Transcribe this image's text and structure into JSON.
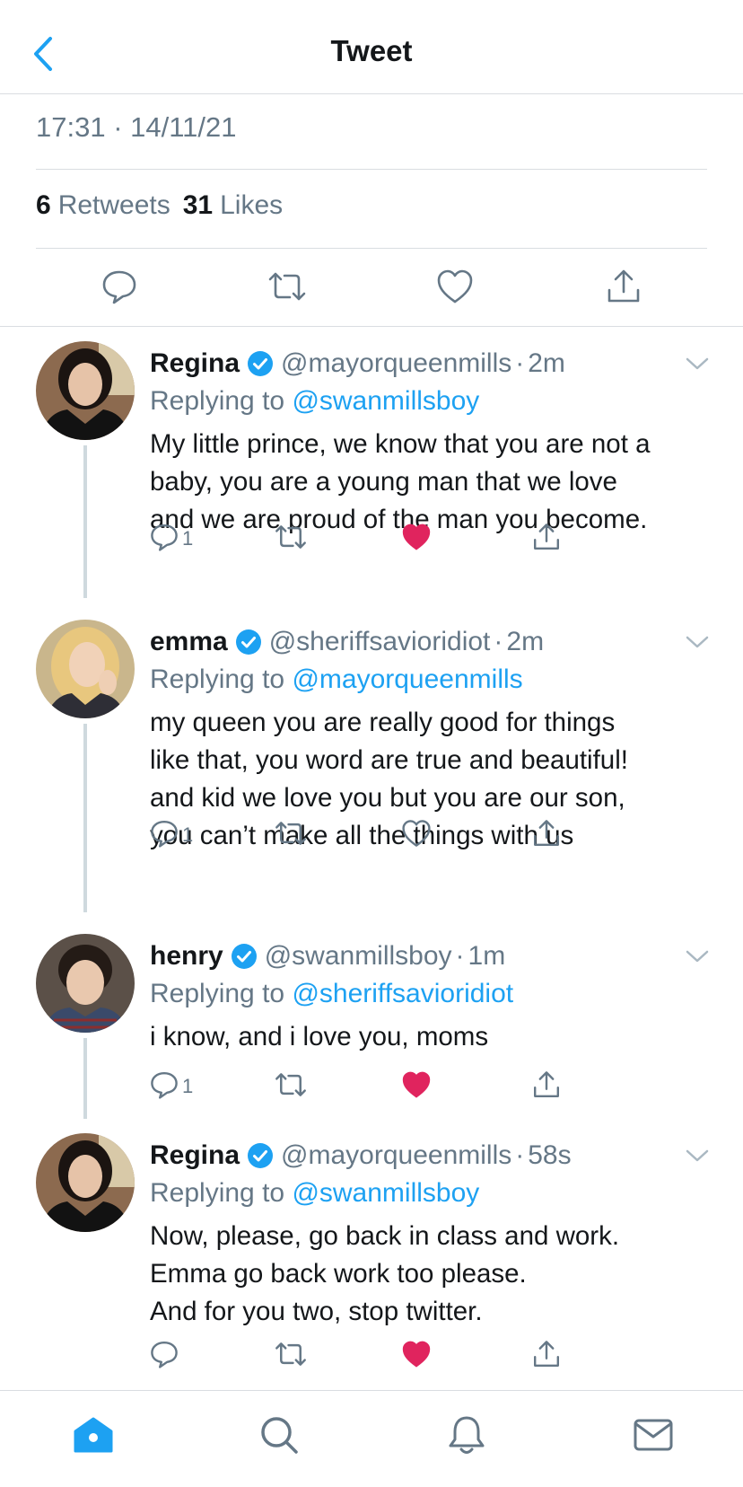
{
  "header": {
    "title": "Tweet"
  },
  "meta": {
    "timestamp": "17:31 · 14/11/21"
  },
  "stats": {
    "retweets_count": "6",
    "retweets_label": "Retweets",
    "likes_count": "31",
    "likes_label": "Likes"
  },
  "colors": {
    "accent": "#1da1f2",
    "like": "#e0245e",
    "muted": "#657786",
    "divider": "#d9dde1",
    "verified": "#1da1f2"
  },
  "icons": {
    "header": "chevron-left-icon",
    "actions": [
      "reply-icon",
      "retweet-icon",
      "like-icon",
      "share-icon"
    ],
    "tabbar": [
      "home-icon",
      "search-icon",
      "notifications-icon",
      "messages-icon"
    ]
  },
  "tweets": [
    {
      "name": "Regina",
      "handle": "@mayorqueenmills",
      "dot": "·",
      "time": "2m",
      "replying_prefix": "Replying to",
      "replying_to": "@swanmillsboy",
      "lines": [
        "My little prince, we know that you are not a",
        "baby, you are a young man that we love",
        "and we are proud of the man you become."
      ],
      "reply_count": "1",
      "liked": true
    },
    {
      "name": "emma",
      "handle": "@sheriffsavioridiot",
      "dot": "·",
      "time": "2m",
      "replying_prefix": "Replying to",
      "replying_to": "@mayorqueenmills",
      "lines": [
        "my queen you are really good for things",
        "like that, you word are true and beautiful!",
        "and kid we love you but you are our son,",
        "you can’t make all the things with us"
      ],
      "reply_count": "1",
      "liked": false
    },
    {
      "name": "henry",
      "handle": "@swanmillsboy",
      "dot": "·",
      "time": "1m",
      "replying_prefix": "Replying to",
      "replying_to": "@sheriffsavioridiot",
      "lines": [
        "i know, and i love you, moms"
      ],
      "reply_count": "1",
      "liked": true
    },
    {
      "name": "Regina",
      "handle": "@mayorqueenmills",
      "dot": "·",
      "time": "58s",
      "replying_prefix": "Replying to",
      "replying_to": "@swanmillsboy",
      "lines": [
        "Now, please, go back in class and work.",
        "Emma go back work too please.",
        "And for you two, stop twitter."
      ],
      "reply_count": "",
      "liked": true
    }
  ]
}
